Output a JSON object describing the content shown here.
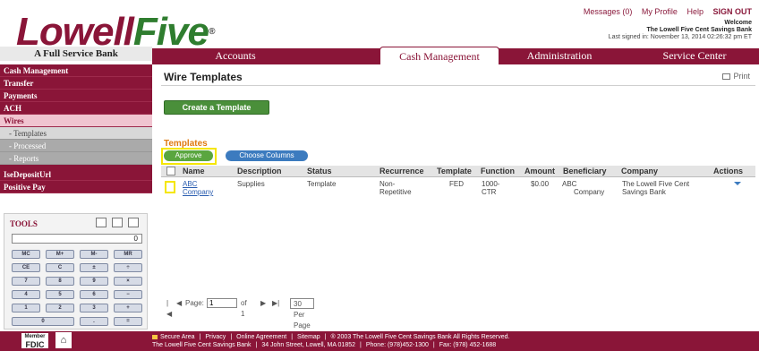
{
  "header": {
    "links": [
      "Messages (0)",
      "My Profile",
      "Help",
      "SIGN OUT"
    ],
    "welcome": "Welcome",
    "bank_name": "The Lowell Five Cent Savings Bank",
    "last_signed": "Last signed in: November 13, 2014 02:26:32 pm ET"
  },
  "logo": {
    "part1": "Lowell",
    "part2": "Five",
    "reg": "®",
    "tagline": "A Full Service Bank"
  },
  "tabs": [
    {
      "label": "Accounts"
    },
    {
      "label": "Cash Management"
    },
    {
      "label": "Administration"
    },
    {
      "label": "Service Center"
    }
  ],
  "sidebar": {
    "items": [
      "Cash Management",
      "Transfer",
      "Payments",
      "ACH",
      "Wires"
    ],
    "sub_items": [
      "- Templates",
      "- Processed",
      "- Reports"
    ],
    "bottom_items": [
      "IseDepositUrl",
      "Positive Pay"
    ]
  },
  "tools": {
    "title": "TOOLS",
    "display": "0",
    "keys": [
      "MC",
      "M+",
      "M-",
      "MR",
      "CE",
      "C",
      "±",
      "÷",
      "7",
      "8",
      "9",
      "×",
      "4",
      "5",
      "6",
      "−",
      "1",
      "2",
      "3",
      "+",
      "0",
      ".",
      "="
    ]
  },
  "main": {
    "title": "Wire Templates",
    "print": "Print",
    "create_button": "Create a Template",
    "section_title": "Templates",
    "approve_button": "Approve",
    "choose_columns_button": "Choose Columns",
    "columns": [
      "Name",
      "Description",
      "Status",
      "Recurrence",
      "Template",
      "Function",
      "Amount",
      "Beneficiary",
      "Company",
      "Actions"
    ],
    "rows": [
      {
        "name_line1": "ABC",
        "name_line2": "Company",
        "description": "Supplies",
        "status": "Template",
        "recurrence_line1": "Non-",
        "recurrence_line2": "Repetitive",
        "template": "FED",
        "function_line1": "1000-",
        "function_line2": "CTR",
        "amount": "$0.00",
        "beneficiary_line1": "ABC",
        "beneficiary_line2": "Company",
        "company_line1": "The Lowell Five Cent",
        "company_line2": "Savings Bank"
      }
    ]
  },
  "pager": {
    "first": "|◀",
    "prev": "◀",
    "page_label": "Page:",
    "page_value": "1",
    "of_label": "of 1",
    "next": "▶",
    "last": "▶|",
    "per_page": "30 Per Page"
  },
  "footer": {
    "line1": [
      "Secure Area",
      "Privacy",
      "Online Agreement",
      "Sitemap",
      "® 2003 The Lowell Five Cent Savings Bank All Rights Reserved."
    ],
    "line2": [
      "The Lowell Five Cent Savings Bank",
      "34 John Street, Lowell, MA 01852",
      "Phone: (978)452-1300",
      "Fax: (978) 452-1688"
    ],
    "fdic_line1": "Member",
    "fdic_line2": "FDIC"
  }
}
